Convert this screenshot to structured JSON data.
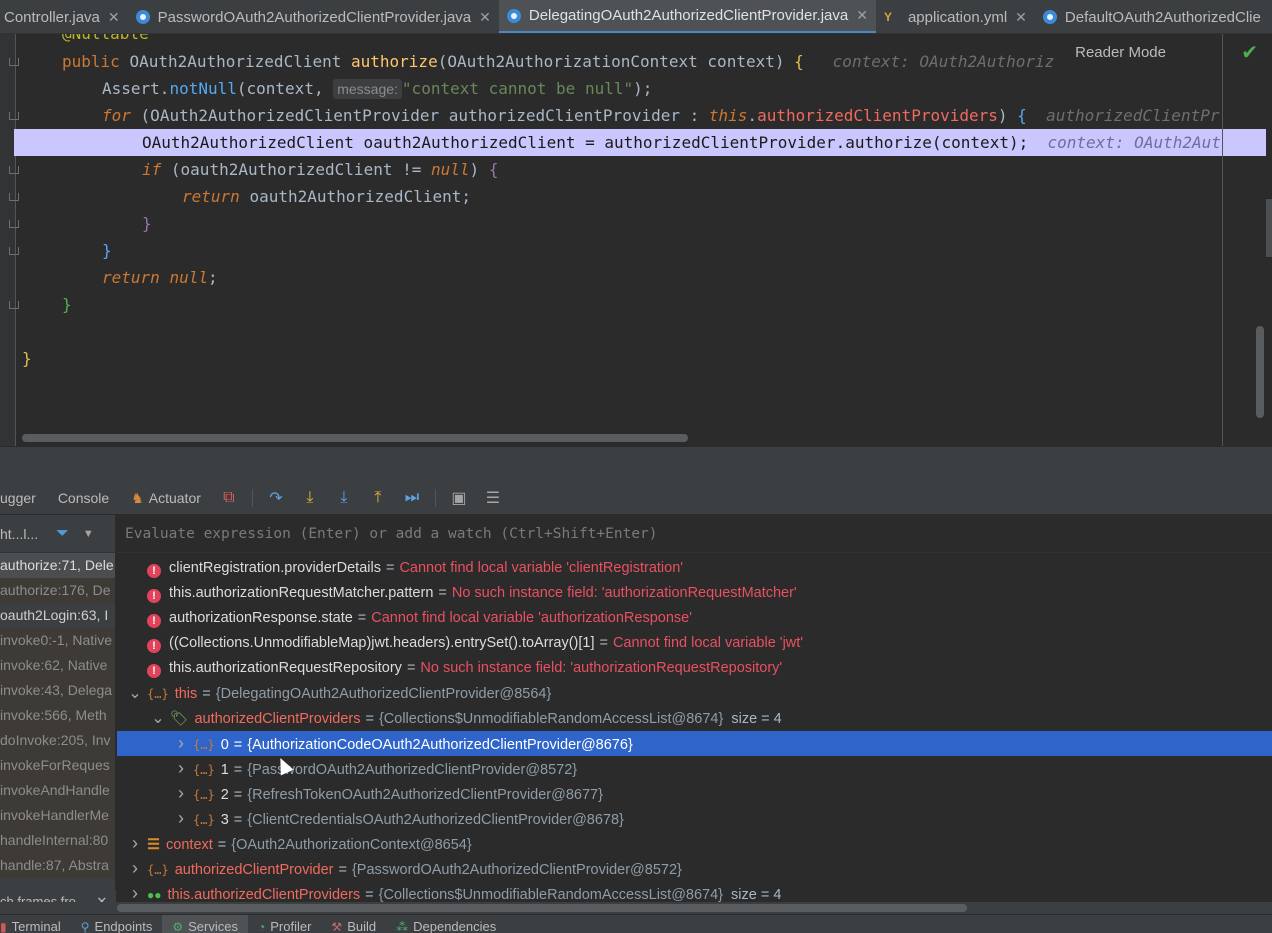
{
  "tabs": [
    {
      "label": "Controller.java",
      "icon": "none",
      "active": false
    },
    {
      "label": "PasswordOAuth2AuthorizedClientProvider.java",
      "icon": "class-icon",
      "active": false
    },
    {
      "label": "DelegatingOAuth2AuthorizedClientProvider.java",
      "icon": "class-icon",
      "active": true
    },
    {
      "label": "application.yml",
      "icon": "yml-icon",
      "active": false
    },
    {
      "label": "DefaultOAuth2AuthorizedClie",
      "icon": "class-icon",
      "active": false
    }
  ],
  "editor": {
    "reader_mode": "Reader Mode",
    "annotation_line": "@Nullable",
    "line1": {
      "kw": "public",
      "type": "OAuth2AuthorizedClient",
      "fn": "authorize",
      "sig": "(OAuth2AuthorizationContext context)",
      "brace": "{",
      "hint": "context: OAuth2Authoriz"
    },
    "line2": {
      "cls": "Assert",
      "meth": "notNull",
      "arg": "context,",
      "param_hint": "message:",
      "str": "\"context cannot be null\"",
      "end": ");"
    },
    "line3": {
      "kw": "for",
      "decl": "(OAuth2AuthorizedClientProvider authorizedClientProvider :",
      "this": "this",
      "field": "authorizedClientProviders",
      "end": ")",
      "brace": "{",
      "hint": "authorizedClientPr"
    },
    "line4": {
      "code": "OAuth2AuthorizedClient oauth2AuthorizedClient = authorizedClientProvider.authorize(context);",
      "hint": "context: OAuth2Aut"
    },
    "line5": {
      "kw": "if",
      "cond": "(oauth2AuthorizedClient !=",
      "null": "null",
      "end": ")",
      "brace": "{"
    },
    "line6": {
      "kw": "return",
      "val": "oauth2AuthorizedClient;"
    },
    "line7": {
      "brace": "}"
    },
    "line8": {
      "brace": "}"
    },
    "line9": {
      "kw": "return",
      "null": "null",
      "end": ";"
    },
    "line10": {
      "brace": "}"
    },
    "line11": {
      "brace": "}"
    }
  },
  "debug_toolbar": {
    "debugger": "ugger",
    "console": "Console",
    "actuator": "Actuator"
  },
  "frames": {
    "thread": "ht...l...",
    "items": [
      {
        "label": "authorize:71, Dele",
        "kind": "cur"
      },
      {
        "label": "authorize:176, De",
        "kind": "lib"
      },
      {
        "label": "oauth2Login:63, I",
        "kind": "user"
      },
      {
        "label": "invoke0:-1, Native",
        "kind": "lib"
      },
      {
        "label": "invoke:62, Native",
        "kind": "lib"
      },
      {
        "label": "invoke:43, Delega",
        "kind": "lib"
      },
      {
        "label": "invoke:566, Meth",
        "kind": "lib"
      },
      {
        "label": "doInvoke:205, Inv",
        "kind": "lib"
      },
      {
        "label": "invokeForReques",
        "kind": "lib"
      },
      {
        "label": "invokeAndHandle",
        "kind": "lib"
      },
      {
        "label": "invokeHandlerMe",
        "kind": "lib"
      },
      {
        "label": "handleInternal:80",
        "kind": "lib"
      },
      {
        "label": "handle:87, Abstra",
        "kind": "lib"
      }
    ],
    "footer": "ch frames fro..."
  },
  "evaluate": {
    "placeholder": "Evaluate expression (Enter) or add a watch (Ctrl+Shift+Enter)"
  },
  "variables": [
    {
      "kind": "error",
      "name": "clientRegistration.providerDetails",
      "value": "Cannot find local variable 'clientRegistration'"
    },
    {
      "kind": "error",
      "name": "this.authorizationRequestMatcher.pattern",
      "value": "No such instance field: 'authorizationRequestMatcher'"
    },
    {
      "kind": "error",
      "name": "authorizationResponse.state",
      "value": "Cannot find local variable 'authorizationResponse'"
    },
    {
      "kind": "error",
      "name": "((Collections.UnmodifiableMap)jwt.headers).entrySet().toArray()[1]",
      "value": "Cannot find local variable 'jwt'"
    },
    {
      "kind": "error",
      "name": "this.authorizationRequestRepository",
      "value": "No such instance field: 'authorizationRequestRepository'"
    },
    {
      "kind": "object",
      "expanded": true,
      "indent": 0,
      "name": "this",
      "value": "{DelegatingOAuth2AuthorizedClientProvider@8564}"
    },
    {
      "kind": "tag",
      "expanded": true,
      "indent": 1,
      "name": "authorizedClientProviders",
      "value": "{Collections$UnmodifiableRandomAccessList@8674}",
      "size": "size = 4"
    },
    {
      "kind": "item",
      "indent": 2,
      "name": "0",
      "value": "{AuthorizationCodeOAuth2AuthorizedClientProvider@8676}",
      "selected": true
    },
    {
      "kind": "item",
      "indent": 2,
      "name": "1",
      "value": "{PasswordOAuth2AuthorizedClientProvider@8572}"
    },
    {
      "kind": "item",
      "indent": 2,
      "name": "2",
      "value": "{RefreshTokenOAuth2AuthorizedClientProvider@8677}"
    },
    {
      "kind": "item",
      "indent": 2,
      "name": "3",
      "value": "{ClientCredentialsOAuth2AuthorizedClientProvider@8678}"
    },
    {
      "kind": "param",
      "indent": 0,
      "name": "context",
      "value": "{OAuth2AuthorizationContext@8654}"
    },
    {
      "kind": "object",
      "indent": 0,
      "name": "authorizedClientProvider",
      "value": "{PasswordOAuth2AuthorizedClientProvider@8572}"
    },
    {
      "kind": "watch",
      "indent": 0,
      "name": "this.authorizedClientProviders",
      "value": "{Collections$UnmodifiableRandomAccessList@8674}",
      "size": "size = 4"
    }
  ],
  "bottom_tools": [
    {
      "label": "Terminal",
      "icon": "terminal-icon"
    },
    {
      "label": "Endpoints",
      "icon": "endpoints-icon"
    },
    {
      "label": "Services",
      "icon": "services-icon",
      "active": true
    },
    {
      "label": "Profiler",
      "icon": "profiler-icon"
    },
    {
      "label": "Build",
      "icon": "build-icon"
    },
    {
      "label": "Dependencies",
      "icon": "dependencies-icon"
    }
  ]
}
